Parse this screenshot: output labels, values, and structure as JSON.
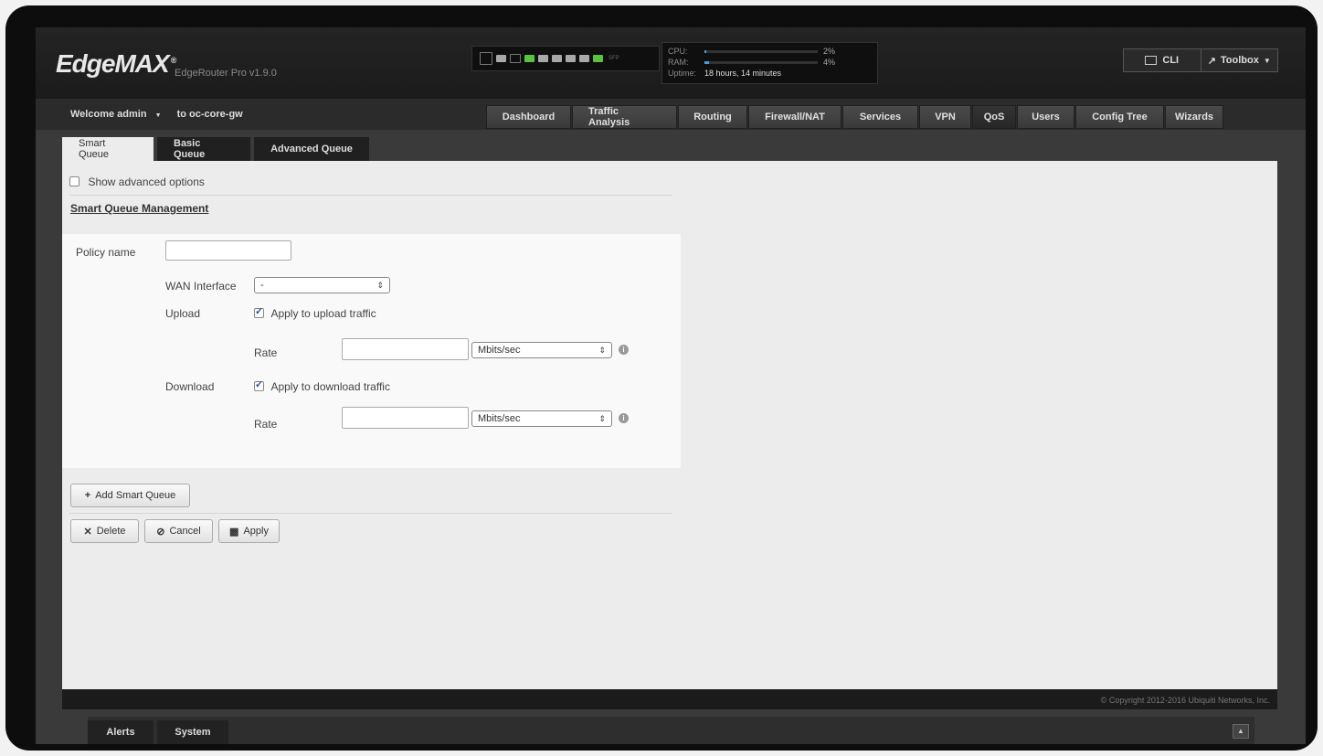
{
  "app": {
    "logo": "EdgeMAX",
    "logo_mark": "®",
    "model": "EdgeRouter Pro v1.9.0"
  },
  "status": {
    "cpu_label": "CPU:",
    "cpu_value": "2%",
    "cpu_fraction": 0.02,
    "ram_label": "RAM:",
    "ram_value": "4%",
    "ram_fraction": 0.04,
    "uptime_label": "Uptime:",
    "uptime_value": "18 hours, 14 minutes",
    "sfp_label": "SFP"
  },
  "toolbar": {
    "cli_label": "CLI",
    "toolbox_label": "Toolbox"
  },
  "user": {
    "welcome": "Welcome admin",
    "host": "to oc-core-gw"
  },
  "nav": {
    "tabs": [
      {
        "label": "Dashboard"
      },
      {
        "label": "Traffic Analysis"
      },
      {
        "label": "Routing"
      },
      {
        "label": "Firewall/NAT"
      },
      {
        "label": "Services"
      },
      {
        "label": "VPN"
      },
      {
        "label": "QoS"
      },
      {
        "label": "Users"
      },
      {
        "label": "Config Tree"
      },
      {
        "label": "Wizards"
      }
    ],
    "active": "QoS"
  },
  "subtabs": [
    {
      "label": "Smart Queue"
    },
    {
      "label": "Basic Queue"
    },
    {
      "label": "Advanced Queue"
    }
  ],
  "form": {
    "show_advanced": "Show advanced options",
    "section_title": "Smart Queue Management",
    "policy_name_label": "Policy name",
    "policy_name_value": "",
    "wan_label": "WAN Interface",
    "wan_value": "-",
    "upload_label": "Upload",
    "upload_apply": "Apply to upload traffic",
    "upload_rate_label": "Rate",
    "upload_unit": "Mbits/sec",
    "download_label": "Download",
    "download_apply": "Apply to download traffic",
    "download_rate_label": "Rate",
    "download_unit": "Mbits/sec"
  },
  "actions": {
    "add_label": "Add Smart Queue",
    "delete_label": "Delete",
    "cancel_label": "Cancel",
    "apply_label": "Apply"
  },
  "footer": {
    "copyright": "© Copyright 2012-2016 Ubiquiti Networks, Inc."
  },
  "bottom_tabs": [
    {
      "label": "Alerts"
    },
    {
      "label": "System"
    }
  ]
}
